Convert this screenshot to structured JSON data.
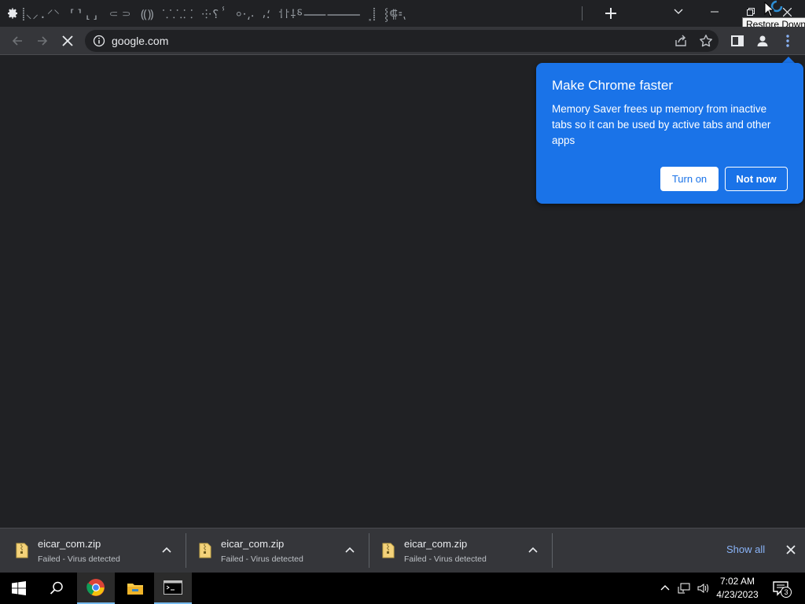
{
  "titlebar": {
    "tab_strip_text": "⸽⸜⸝.⸍⸌ ⸢⸣⸤⸥ ⸦⸧ ⸨⸩ ⸪⸫⸬ ⸭⸮ⸯ ⸰⸱⸲⸳ ⸴⸵ ⸶⸷⸸⸹⸺⸻ ⸼⸽ ⸾⸿⹀⹁",
    "tooltip": "Restore Down"
  },
  "toolbar": {
    "url": "google.com"
  },
  "bubble": {
    "title": "Make Chrome faster",
    "body": "Memory Saver frees up memory from inactive tabs so it can be used by active tabs and other apps",
    "turn_on": "Turn on",
    "not_now": "Not now"
  },
  "downloads": {
    "items": [
      {
        "name": "eicar_com.zip",
        "status": "Failed - Virus detected"
      },
      {
        "name": "eicar_com.zip",
        "status": "Failed - Virus detected"
      },
      {
        "name": "eicar_com.zip",
        "status": "Failed - Virus detected"
      }
    ],
    "show_all": "Show all"
  },
  "taskbar": {
    "time": "7:02 AM",
    "date": "4/23/2023",
    "notification_count": "3"
  },
  "colors": {
    "bubble_blue": "#1a73e8",
    "link_blue": "#8ab4f8",
    "dark_bg": "#202124",
    "toolbar_bg": "#35363a"
  }
}
